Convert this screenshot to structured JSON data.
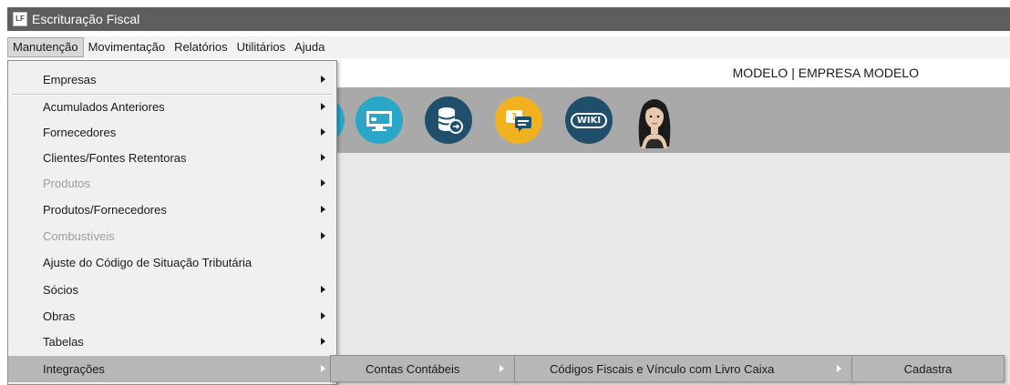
{
  "window": {
    "title": "Escrituração Fiscal",
    "app_icon_text": "LF"
  },
  "menubar": {
    "items": [
      {
        "label": "Manutenção"
      },
      {
        "label": "Movimentação"
      },
      {
        "label": "Relatórios"
      },
      {
        "label": "Utilitários"
      },
      {
        "label": "Ajuda"
      }
    ]
  },
  "company": {
    "label": "MODELO | EMPRESA MODELO"
  },
  "toolbar": {
    "icons": [
      "partial-round-icon",
      "remote-monitor-icon",
      "database-export-icon",
      "chat-help-icon",
      "wiki-icon",
      "assistant-avatar"
    ],
    "wiki_text": "WIKI"
  },
  "dropdown": {
    "items": [
      {
        "label": "Empresas",
        "submenu": true,
        "enabled": true
      },
      {
        "label": "Acumulados Anteriores",
        "submenu": true,
        "enabled": true
      },
      {
        "label": "Fornecedores",
        "submenu": true,
        "enabled": true
      },
      {
        "label": "Clientes/Fontes Retentoras",
        "submenu": true,
        "enabled": true
      },
      {
        "label": "Produtos",
        "submenu": true,
        "enabled": false
      },
      {
        "label": "Produtos/Fornecedores",
        "submenu": true,
        "enabled": true
      },
      {
        "label": "Combustíveis",
        "submenu": true,
        "enabled": false
      },
      {
        "label": "Ajuste do Código de Situação Tributária",
        "submenu": false,
        "enabled": true
      },
      {
        "label": "Sócios",
        "submenu": true,
        "enabled": true
      },
      {
        "label": "Obras",
        "submenu": true,
        "enabled": true
      },
      {
        "label": "Tabelas",
        "submenu": true,
        "enabled": true
      },
      {
        "label": "Integrações",
        "submenu": true,
        "enabled": true,
        "highlighted": true
      }
    ]
  },
  "submenus": [
    {
      "label": "Contas Contábeis"
    },
    {
      "label": "Códigos Fiscais e Vínculo com Livro Caixa"
    },
    {
      "label": "Cadastra"
    }
  ],
  "colors": {
    "titlebar": "#5e5e5e",
    "toolbar": "#a9a9a9",
    "highlight": "#b7b7b7",
    "icon_teal": "#2aa6c8",
    "icon_navy": "#1f4f6b",
    "icon_yellow": "#f2b21f"
  }
}
